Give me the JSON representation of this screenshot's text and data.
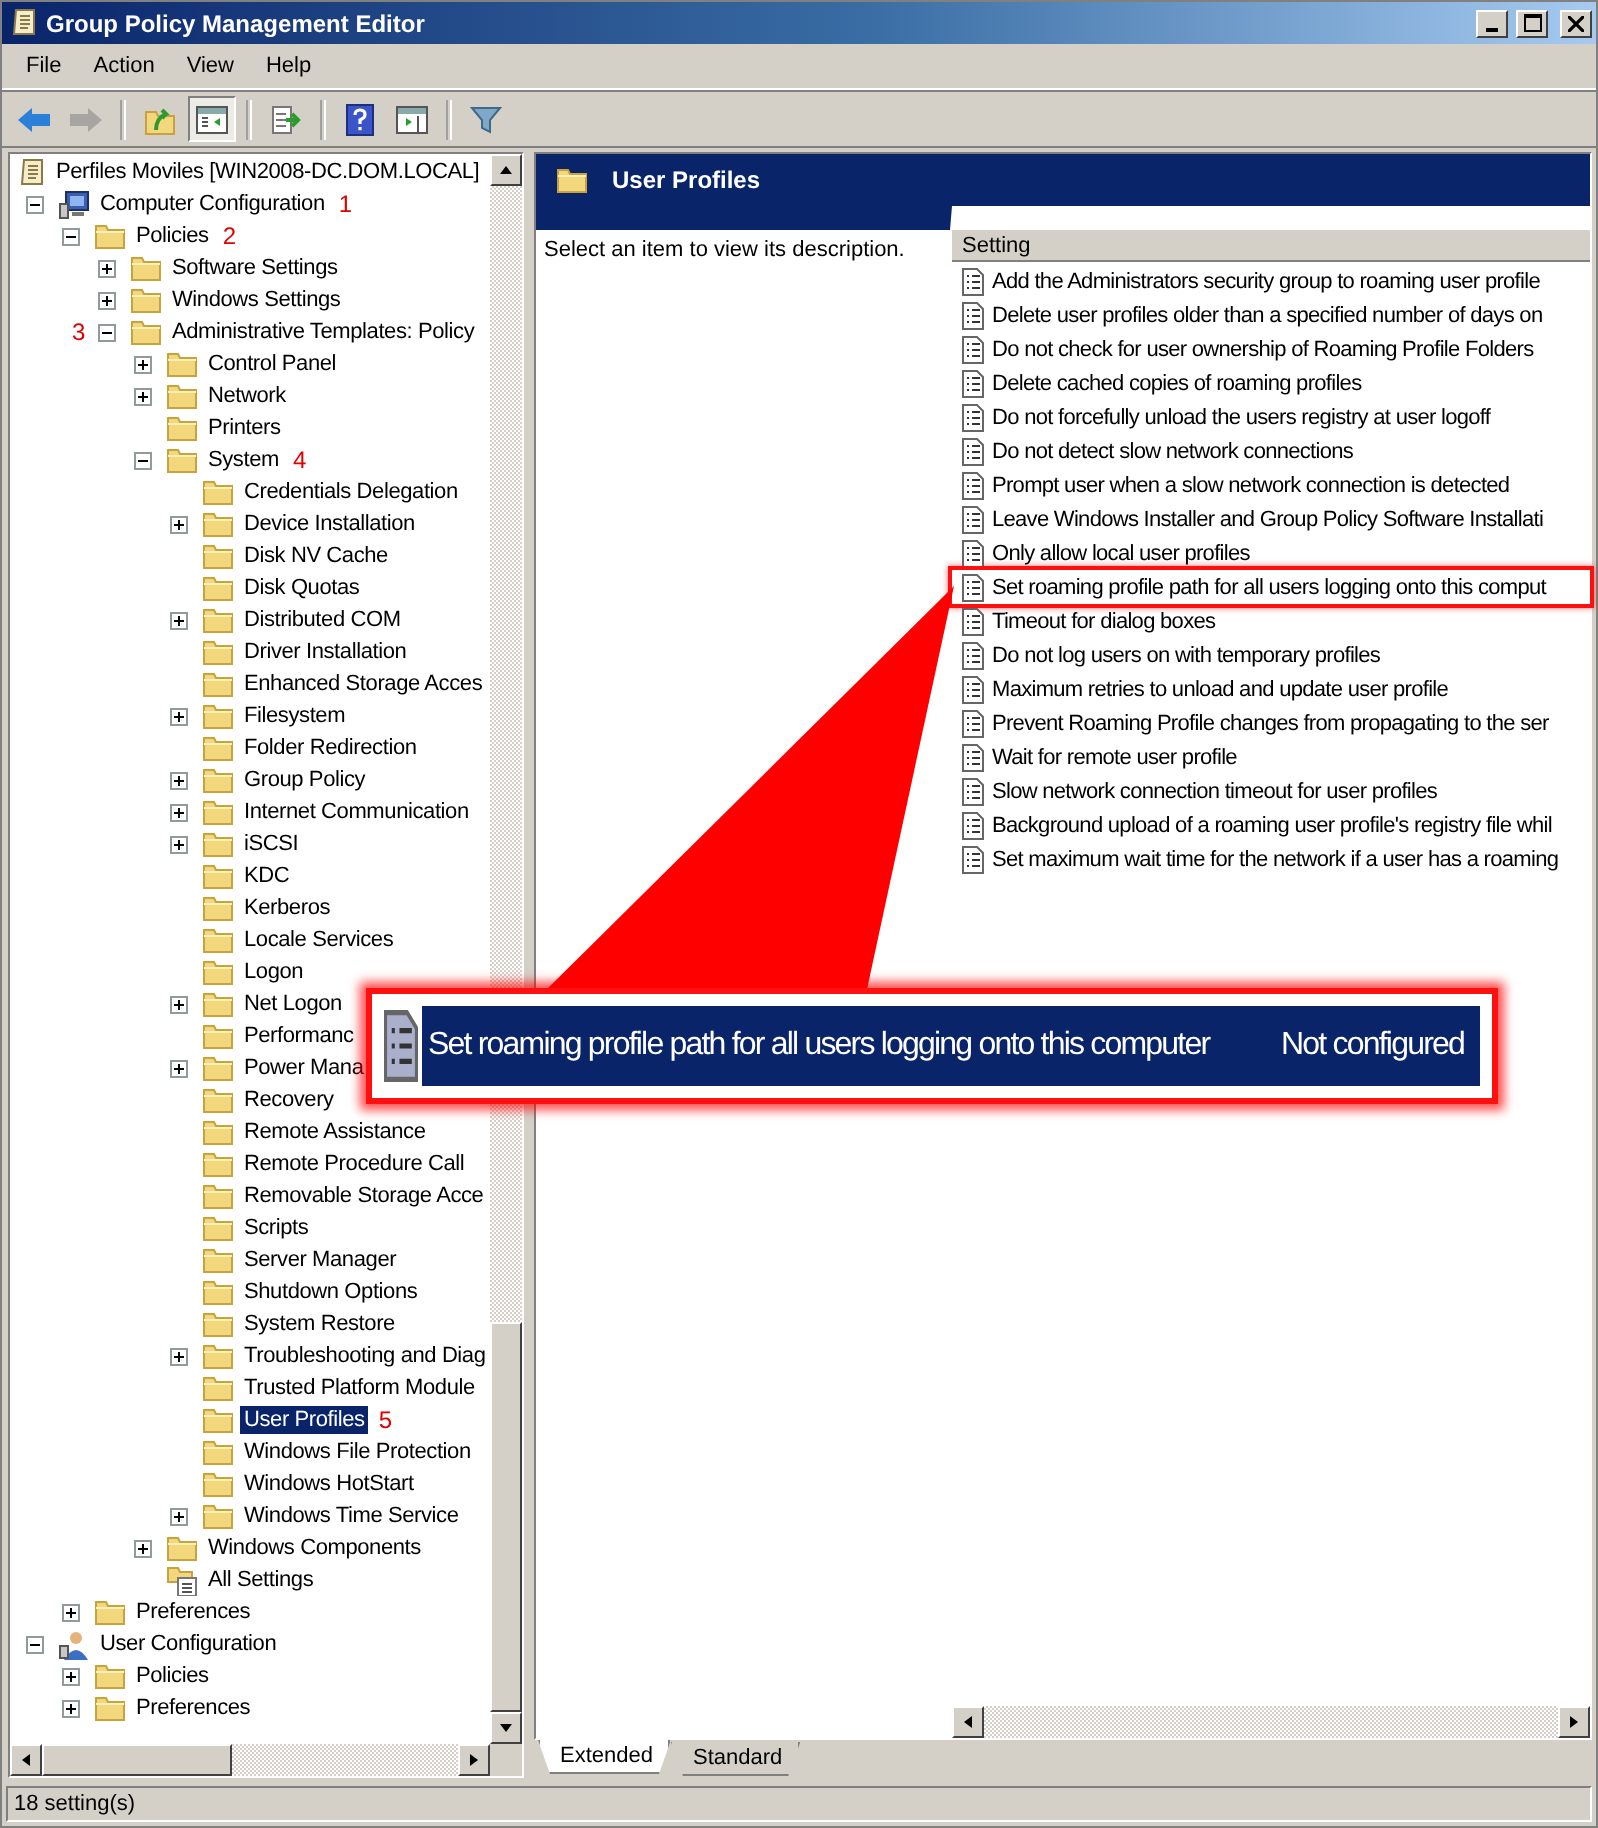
{
  "window": {
    "title": "Group Policy Management Editor"
  },
  "menu": [
    "File",
    "Action",
    "View",
    "Help"
  ],
  "toolbar": [
    {
      "kind": "back",
      "disabled": false,
      "pressed": false
    },
    {
      "kind": "forward",
      "disabled": true,
      "pressed": false
    },
    {
      "kind": "separator"
    },
    {
      "kind": "up",
      "disabled": false,
      "pressed": false
    },
    {
      "kind": "tree",
      "disabled": false,
      "pressed": true
    },
    {
      "kind": "separator"
    },
    {
      "kind": "export",
      "disabled": false,
      "pressed": false
    },
    {
      "kind": "separator"
    },
    {
      "kind": "help",
      "disabled": false,
      "pressed": false
    },
    {
      "kind": "pane",
      "disabled": false,
      "pressed": false
    },
    {
      "kind": "separator"
    },
    {
      "kind": "filter",
      "disabled": false,
      "pressed": false
    }
  ],
  "tree": {
    "root": "Perfiles Moviles [WIN2008-DC.DOM.LOCAL]",
    "items": [
      {
        "label": "Computer Configuration",
        "kind": "computer",
        "expanded": true,
        "selected": false,
        "badge": "1",
        "children": [
          {
            "label": "Policies",
            "kind": "folder",
            "expanded": true,
            "selected": false,
            "badge": "2",
            "children": [
              {
                "label": "Software Settings",
                "kind": "folder",
                "expanded": false,
                "selected": false
              },
              {
                "label": "Windows Settings",
                "kind": "folder",
                "expanded": false,
                "selected": false
              },
              {
                "label": "Administrative Templates: Policy",
                "kind": "folder",
                "expanded": true,
                "selected": false,
                "badge": "3",
                "badge_left": true,
                "children": [
                  {
                    "label": "Control Panel",
                    "kind": "folder",
                    "expanded": false,
                    "selected": false
                  },
                  {
                    "label": "Network",
                    "kind": "folder",
                    "expanded": false,
                    "selected": false
                  },
                  {
                    "label": "Printers",
                    "kind": "folder",
                    "selected": false
                  },
                  {
                    "label": "System",
                    "kind": "folder",
                    "expanded": true,
                    "selected": false,
                    "badge": "4",
                    "children": [
                      {
                        "label": "Credentials Delegation",
                        "kind": "folder",
                        "selected": false
                      },
                      {
                        "label": "Device Installation",
                        "kind": "folder",
                        "expanded": false,
                        "selected": false
                      },
                      {
                        "label": "Disk NV Cache",
                        "kind": "folder",
                        "selected": false
                      },
                      {
                        "label": "Disk Quotas",
                        "kind": "folder",
                        "selected": false
                      },
                      {
                        "label": "Distributed COM",
                        "kind": "folder",
                        "expanded": false,
                        "selected": false
                      },
                      {
                        "label": "Driver Installation",
                        "kind": "folder",
                        "selected": false
                      },
                      {
                        "label": "Enhanced Storage Acces",
                        "kind": "folder",
                        "selected": false
                      },
                      {
                        "label": "Filesystem",
                        "kind": "folder",
                        "expanded": false,
                        "selected": false
                      },
                      {
                        "label": "Folder Redirection",
                        "kind": "folder",
                        "selected": false
                      },
                      {
                        "label": "Group Policy",
                        "kind": "folder",
                        "expanded": false,
                        "selected": false
                      },
                      {
                        "label": "Internet Communication",
                        "kind": "folder",
                        "expanded": false,
                        "selected": false
                      },
                      {
                        "label": "iSCSI",
                        "kind": "folder",
                        "expanded": false,
                        "selected": false
                      },
                      {
                        "label": "KDC",
                        "kind": "folder",
                        "selected": false
                      },
                      {
                        "label": "Kerberos",
                        "kind": "folder",
                        "selected": false
                      },
                      {
                        "label": "Locale Services",
                        "kind": "folder",
                        "selected": false
                      },
                      {
                        "label": "Logon",
                        "kind": "folder",
                        "selected": false
                      },
                      {
                        "label": "Net Logon",
                        "kind": "folder",
                        "expanded": false,
                        "selected": false
                      },
                      {
                        "label": "Performanc",
                        "kind": "folder",
                        "selected": false
                      },
                      {
                        "label": "Power Mana",
                        "kind": "folder",
                        "expanded": false,
                        "selected": false
                      },
                      {
                        "label": "Recovery",
                        "kind": "folder",
                        "selected": false
                      },
                      {
                        "label": "Remote Assistance",
                        "kind": "folder",
                        "selected": false
                      },
                      {
                        "label": "Remote Procedure Call",
                        "kind": "folder",
                        "selected": false
                      },
                      {
                        "label": "Removable Storage Acce",
                        "kind": "folder",
                        "selected": false
                      },
                      {
                        "label": "Scripts",
                        "kind": "folder",
                        "selected": false
                      },
                      {
                        "label": "Server Manager",
                        "kind": "folder",
                        "selected": false
                      },
                      {
                        "label": "Shutdown Options",
                        "kind": "folder",
                        "selected": false
                      },
                      {
                        "label": "System Restore",
                        "kind": "folder",
                        "selected": false
                      },
                      {
                        "label": "Troubleshooting and Diag",
                        "kind": "folder",
                        "expanded": false,
                        "selected": false
                      },
                      {
                        "label": "Trusted Platform Module",
                        "kind": "folder",
                        "selected": false
                      },
                      {
                        "label": "User Profiles",
                        "kind": "folder",
                        "selected": true,
                        "badge": "5"
                      },
                      {
                        "label": "Windows File Protection",
                        "kind": "folder",
                        "selected": false
                      },
                      {
                        "label": "Windows HotStart",
                        "kind": "folder",
                        "selected": false
                      },
                      {
                        "label": "Windows Time Service",
                        "kind": "folder",
                        "expanded": false,
                        "selected": false
                      }
                    ]
                  },
                  {
                    "label": "Windows Components",
                    "kind": "folder",
                    "expanded": false,
                    "selected": false
                  },
                  {
                    "label": "All Settings",
                    "kind": "settings",
                    "selected": false
                  }
                ]
              }
            ]
          },
          {
            "label": "Preferences",
            "kind": "folder",
            "expanded": false,
            "selected": false
          }
        ]
      },
      {
        "label": "User Configuration",
        "kind": "user",
        "expanded": true,
        "selected": false,
        "children": [
          {
            "label": "Policies",
            "kind": "folder",
            "expanded": false,
            "selected": false
          },
          {
            "label": "Preferences",
            "kind": "folder",
            "expanded": false,
            "selected": false
          }
        ]
      }
    ]
  },
  "header": {
    "title": "User Profiles"
  },
  "description": "Select an item to view its description.",
  "settings": {
    "column": "Setting",
    "rows": [
      {
        "label": "Add the Administrators security group to roaming user profile",
        "highlighted": false
      },
      {
        "label": "Delete user profiles older than a specified number of days on",
        "highlighted": false
      },
      {
        "label": "Do not check for user ownership of Roaming Profile Folders",
        "highlighted": false
      },
      {
        "label": "Delete cached copies of roaming profiles",
        "highlighted": false
      },
      {
        "label": "Do not forcefully unload the users registry at user logoff",
        "highlighted": false
      },
      {
        "label": "Do not detect slow network connections",
        "highlighted": false
      },
      {
        "label": "Prompt user when a slow network connection is detected",
        "highlighted": false
      },
      {
        "label": "Leave Windows Installer and Group Policy Software Installati",
        "highlighted": false
      },
      {
        "label": "Only allow local user profiles",
        "highlighted": false
      },
      {
        "label": "Set roaming profile path for all users logging onto this comput",
        "highlighted": true
      },
      {
        "label": "Timeout for dialog boxes",
        "highlighted": false
      },
      {
        "label": "Do not log users on with temporary profiles",
        "highlighted": false
      },
      {
        "label": "Maximum retries to unload and update user profile",
        "highlighted": false
      },
      {
        "label": "Prevent Roaming Profile changes from propagating to the ser",
        "highlighted": false
      },
      {
        "label": "Wait for remote user profile",
        "highlighted": false
      },
      {
        "label": "Slow network connection timeout for user profiles",
        "highlighted": false
      },
      {
        "label": "Background upload of a roaming user profile's registry file whil",
        "highlighted": false
      },
      {
        "label": "Set maximum wait time for the network if a user has a roaming",
        "highlighted": false
      }
    ]
  },
  "callout": {
    "title": "Set roaming profile path for all users logging onto this computer",
    "state": "Not configured"
  },
  "tabs": [
    {
      "label": "Extended",
      "selected": true
    },
    {
      "label": "Standard",
      "selected": false
    }
  ],
  "status_bar": "18 setting(s)"
}
